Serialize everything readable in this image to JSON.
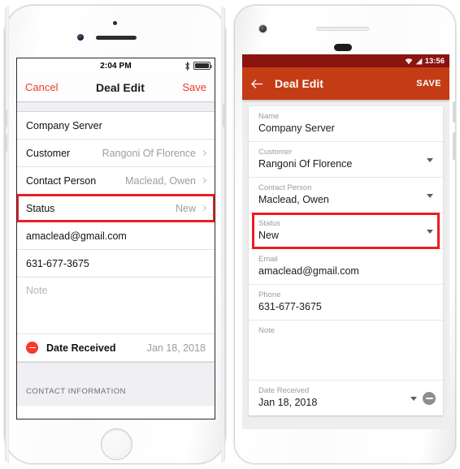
{
  "ios": {
    "status_bar": {
      "time": "2:04 PM",
      "bluetooth_icon": "bluetooth-icon",
      "battery_icon": "battery-full-icon"
    },
    "navbar": {
      "cancel_label": "Cancel",
      "title": "Deal Edit",
      "save_label": "Save"
    },
    "rows": [
      {
        "name": "name",
        "label": "Company Server",
        "value": "",
        "chevron": false
      },
      {
        "name": "customer",
        "label": "Customer",
        "value": "Rangoni Of Florence",
        "chevron": true
      },
      {
        "name": "contact-person",
        "label": "Contact Person",
        "value": "Maclead, Owen",
        "chevron": true
      },
      {
        "name": "status",
        "label": "Status",
        "value": "New",
        "chevron": true
      },
      {
        "name": "email",
        "label": "amaclead@gmail.com",
        "value": "",
        "chevron": false
      },
      {
        "name": "phone",
        "label": "631-677-3675",
        "value": "",
        "chevron": false
      }
    ],
    "note_placeholder": "Note",
    "date_row": {
      "minus_icon": "minus-circle-icon",
      "label": "Date Received",
      "value": "Jan 18, 2018"
    },
    "section_header": "CONTACT INFORMATION",
    "highlight_color": "#ed1c24",
    "accent_color": "#ee3b24"
  },
  "android": {
    "status_bar": {
      "wifi_icon": "wifi-icon",
      "signal_icon": "signal-icon",
      "time": "13:56",
      "background_color": "#8a1410"
    },
    "appbar": {
      "back_icon": "arrow-left-icon",
      "title": "Deal Edit",
      "save_label": "SAVE",
      "background_color": "#c43c16"
    },
    "fields": [
      {
        "name": "name",
        "label": "Name",
        "value": "Company Server",
        "caret": false
      },
      {
        "name": "customer",
        "label": "Customer",
        "value": "Rangoni Of Florence",
        "caret": true
      },
      {
        "name": "contact-person",
        "label": "Contact Person",
        "value": "Maclead, Owen",
        "caret": true
      },
      {
        "name": "status",
        "label": "Status",
        "value": "New",
        "caret": true
      },
      {
        "name": "email",
        "label": "Email",
        "value": "amaclead@gmail.com",
        "caret": false
      },
      {
        "name": "phone",
        "label": "Phone",
        "value": "631-677-3675",
        "caret": false
      },
      {
        "name": "note",
        "label": "Note",
        "value": "",
        "caret": false
      }
    ],
    "date_field": {
      "label": "Date Received",
      "value": "Jan 18, 2018",
      "caret_icon": "chevron-down-icon",
      "minus_icon": "minus-circle-icon"
    },
    "highlight_color": "#ed1c24"
  }
}
